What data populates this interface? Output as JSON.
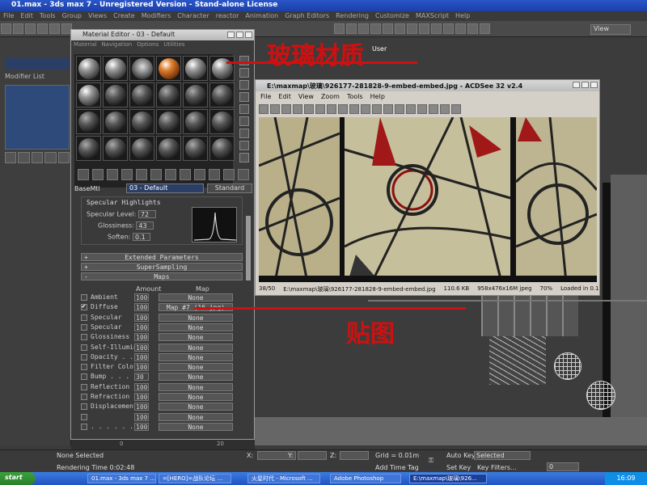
{
  "max": {
    "title": "01.max - 3ds max 7 - Unregistered Version - Stand-alone License",
    "menu": [
      "File",
      "Edit",
      "Tools",
      "Group",
      "Views",
      "Create",
      "Modifiers",
      "Character",
      "reactor",
      "Animation",
      "Graph Editors",
      "Rendering",
      "Customize",
      "MAXScript",
      "Help"
    ],
    "view_dropdown": "View",
    "modifier_list": "Modifier List",
    "viewport_label": "User"
  },
  "material_editor": {
    "title": "Material Editor - 03 - Default",
    "menu": [
      "Material",
      "Navigation",
      "Options",
      "Utilities"
    ],
    "basemtl_label": "BaseMtl",
    "material_name": "03 - Default",
    "material_type": "Standard",
    "specular": {
      "title": "Specular Highlights",
      "level_label": "Specular Level:",
      "level_value": "72",
      "gloss_label": "Glossiness:",
      "gloss_value": "43",
      "soften_label": "Soften:",
      "soften_value": "0.1"
    },
    "rollouts": [
      "Extended Parameters",
      "SuperSampling",
      "Maps"
    ],
    "maps_header": {
      "amount": "Amount",
      "map": "Map"
    },
    "maps": [
      {
        "name": "Ambient",
        "amount": "100",
        "map": "None",
        "checked": false
      },
      {
        "name": "Diffuse",
        "amount": "100",
        "map": "Map #7 (16.jpg)",
        "checked": true
      },
      {
        "name": "Specular",
        "amount": "100",
        "map": "None",
        "checked": false
      },
      {
        "name": "Specular",
        "amount": "100",
        "map": "None",
        "checked": false
      },
      {
        "name": "Glossiness",
        "amount": "100",
        "map": "None",
        "checked": false
      },
      {
        "name": "Self-Illumin",
        "amount": "100",
        "map": "None",
        "checked": false
      },
      {
        "name": "Opacity . .",
        "amount": "100",
        "map": "None",
        "checked": false
      },
      {
        "name": "Filter Color",
        "amount": "100",
        "map": "None",
        "checked": false
      },
      {
        "name": "Bump . . .",
        "amount": "30",
        "map": "None",
        "checked": false
      },
      {
        "name": "Reflection",
        "amount": "100",
        "map": "None",
        "checked": false
      },
      {
        "name": "Refraction",
        "amount": "100",
        "map": "None",
        "checked": false
      },
      {
        "name": "Displacement",
        "amount": "100",
        "map": "None",
        "checked": false
      },
      {
        "name": "",
        "amount": "100",
        "map": "None",
        "checked": false
      },
      {
        "name": ". . . . . .",
        "amount": "100",
        "map": "None",
        "checked": false
      }
    ]
  },
  "acdsee": {
    "title": "E:\\maxmap\\玻璃\\926177-281828-9-embed-embed.jpg - ACDSee 32 v2.4",
    "menu": [
      "File",
      "Edit",
      "View",
      "Zoom",
      "Tools",
      "Help"
    ],
    "status": [
      "38/50",
      "E:\\maxmap\\玻璃\\926177-281828-9-embed-embed.jpg",
      "110.6 KB",
      "958x476x16M jpeg",
      "70%",
      "Loaded in 0.1 s"
    ]
  },
  "annotations": {
    "glass_material": "玻璃材质",
    "texture_map": "贴图"
  },
  "timeline": {
    "start": "0",
    "mark": "20"
  },
  "status": {
    "selection": "None Selected",
    "render_time": "Rendering Time  0:02:48",
    "x_label": "X:",
    "y_label": "Y:",
    "z_label": "Z:",
    "grid": "Grid = 0.01m",
    "add_time_tag": "Add Time Tag",
    "auto_key": "Auto Key",
    "selected": "Selected",
    "set_key": "Set Key",
    "key_filters": "Key Filters...",
    "frame": "0"
  },
  "taskbar": {
    "start": "start",
    "tasks": [
      "01.max - 3ds max 7 ...",
      "=[HERO]=战队论坛 ...",
      "火星时代 - Microsoft ...",
      "Adobe Photoshop",
      "E:\\maxmap\\玻璃\\926..."
    ],
    "clock": "16:09"
  }
}
